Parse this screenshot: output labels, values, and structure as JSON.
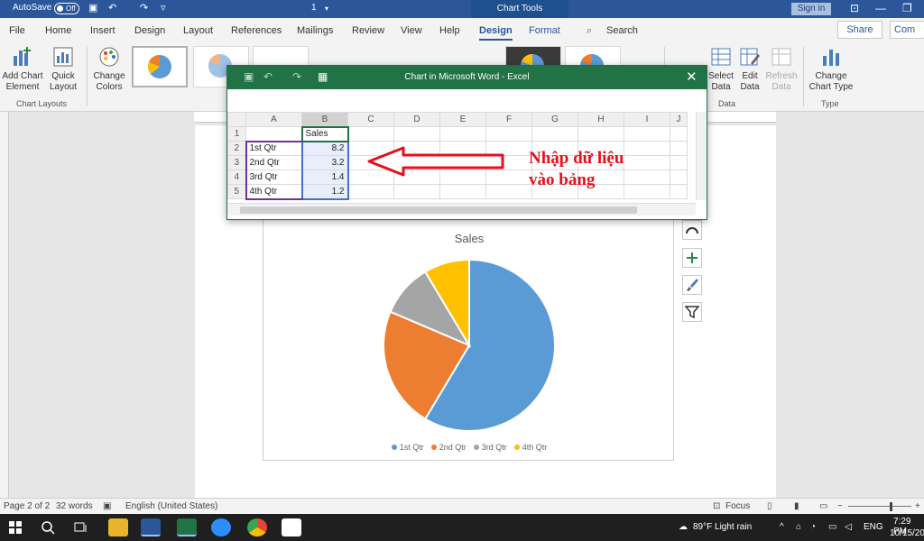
{
  "titlebar": {
    "autosave_label": "AutoSave",
    "autosave_state": "Off",
    "doc_name": "1",
    "context_tab": "Chart Tools",
    "signin": "Sign in"
  },
  "tabs": [
    {
      "label": "File"
    },
    {
      "label": "Home"
    },
    {
      "label": "Insert"
    },
    {
      "label": "Design"
    },
    {
      "label": "Layout"
    },
    {
      "label": "References"
    },
    {
      "label": "Mailings"
    },
    {
      "label": "Review"
    },
    {
      "label": "View"
    },
    {
      "label": "Help"
    },
    {
      "label": "Design"
    },
    {
      "label": "Format"
    }
  ],
  "search_label": "Search",
  "share_label": "Share",
  "comments_label": "Com",
  "ribbon": {
    "add_chart_element": "Add Chart Element",
    "quick_layout": "Quick Layout",
    "chart_layouts_group": "Chart Layouts",
    "change_colors": "Change Colors",
    "select_data": "Select Data",
    "edit_data": "Edit Data",
    "refresh_data": "Refresh Data",
    "data_group": "Data",
    "change_chart_type": "Change Chart Type",
    "type_group": "Type"
  },
  "excel": {
    "title": "Chart in Microsoft Word - Excel",
    "columns": [
      "A",
      "B",
      "C",
      "D",
      "E",
      "F",
      "G",
      "H",
      "I",
      "J"
    ],
    "rows": [
      {
        "num": "1",
        "a": "",
        "b": "Sales"
      },
      {
        "num": "2",
        "a": "1st Qtr",
        "b": "8.2"
      },
      {
        "num": "3",
        "a": "2nd Qtr",
        "b": "3.2"
      },
      {
        "num": "4",
        "a": "3rd Qtr",
        "b": "1.4"
      },
      {
        "num": "5",
        "a": "4th Qtr",
        "b": "1.2"
      }
    ]
  },
  "annotation": {
    "line1": "Nhập dữ liệu",
    "line2": "vào bảng",
    "color": "#e5101b"
  },
  "chart_data": {
    "type": "pie",
    "title": "Sales",
    "categories": [
      "1st Qtr",
      "2nd Qtr",
      "3rd Qtr",
      "4th Qtr"
    ],
    "values": [
      8.2,
      3.2,
      1.4,
      1.2
    ],
    "colors": [
      "#5b9bd5",
      "#ed7d31",
      "#a5a5a5",
      "#ffc000"
    ],
    "legend": "bottom"
  },
  "status": {
    "page": "Page 2 of 2",
    "words": "32 words",
    "language": "English (United States)",
    "focus": "Focus"
  },
  "taskbar": {
    "weather": "89°F  Light rain",
    "lang": "ENG",
    "time": "7:29 PM",
    "date": "10/15/20"
  }
}
